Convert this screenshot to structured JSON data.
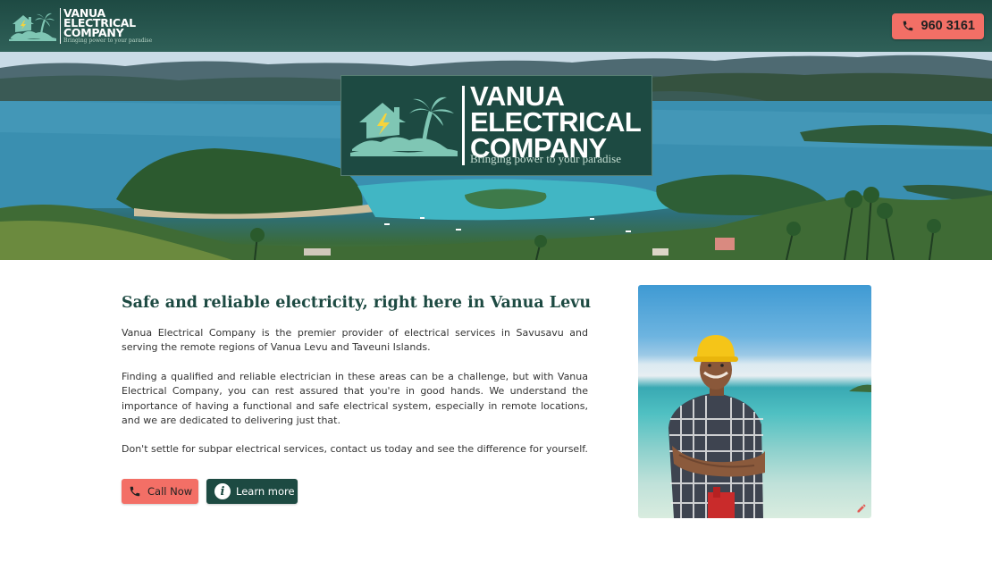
{
  "navbar": {
    "logo": {
      "title_line1": "VANUA",
      "title_line2": "ELECTRICAL",
      "title_line3": "COMPANY",
      "tagline": "Bringing power to your paradise",
      "icon": "house-island-palm-logo"
    },
    "phone_button": {
      "label": "960 3161",
      "icon": "phone-icon"
    }
  },
  "hero": {
    "logo": {
      "title_line1": "VANUA",
      "title_line2": "ELECTRICAL",
      "title_line3": "COMPANY",
      "tagline": "Bringing power to your paradise",
      "icon": "house-island-palm-logo"
    }
  },
  "main": {
    "headline": "Safe and reliable electricity, right here in Vanua Levu",
    "paragraphs": [
      "Vanua Electrical Company is the premier provider of electrical services in Savusavu and serving the remote regions of Vanua Levu and Taveuni Islands.",
      "Finding a qualified and reliable electrician in these areas can be a challenge, but with Vanua Electrical Company, you can rest assured that you're in good hands. We understand the importance of having a functional and safe electrical system, especially in remote locations, and we are dedicated to delivering just that.",
      "Don't settle for subpar electrical services, contact us today and see the difference for yourself."
    ],
    "buttons": {
      "call_now": "Call Now",
      "learn_more": "Learn more"
    }
  },
  "colors": {
    "brand_dark_green": "#1d4a42",
    "accent_coral": "#f36f66",
    "logo_teal": "#7fc6b4"
  }
}
